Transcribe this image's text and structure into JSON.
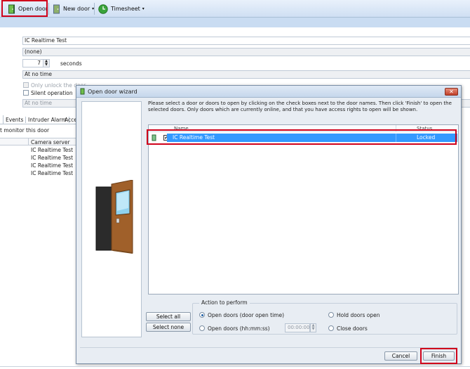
{
  "toolbar": {
    "open_door_label": "Open door",
    "new_door_label": "New door",
    "timesheet_label": "Timesheet"
  },
  "background": {
    "door_name": "IC Realtime Test",
    "none_value": "(none)",
    "seconds_value": "7",
    "seconds_unit": "seconds",
    "at_no_time_1": "At no time",
    "only_unlock_label": "Only unlock the door",
    "silent_operation_label": "Silent operation",
    "at_no_time_2": "At no time",
    "tabs": [
      "Events",
      "Intruder Alarm",
      "Acce"
    ],
    "monitor_text": "t monitor this door",
    "camera_server_header": "Camera server",
    "camera_rows": [
      "IC Realtime Test",
      "IC Realtime Test",
      "IC Realtime Test",
      "IC Realtime Test"
    ]
  },
  "dialog": {
    "title": "Open door wizard",
    "close_symbol": "✕",
    "description": "Please select a door or doors to open by clicking on the check boxes next to the door names. Then click 'Finish' to open the selected doors. Only doors which are currently online, and that you have access rights to open will be shown.",
    "list": {
      "col_name": "Name",
      "col_status": "Status",
      "rows": [
        {
          "name": "IC Realtime Test",
          "status": "Locked",
          "checked": true
        }
      ]
    },
    "select_all_label": "Select all",
    "select_none_label": "Select none",
    "action_group_label": "Action to perform",
    "open_doors_label": "Open doors (door open time)",
    "open_doors_hms_label": "Open doors (hh:mm:ss)",
    "hold_doors_label": "Hold doors open",
    "close_doors_label": "Close doors",
    "time_value": "00:00:00",
    "cancel_label": "Cancel",
    "finish_label": "Finish"
  },
  "colors": {
    "highlight": "#d0021b",
    "selection": "#3399ff"
  }
}
